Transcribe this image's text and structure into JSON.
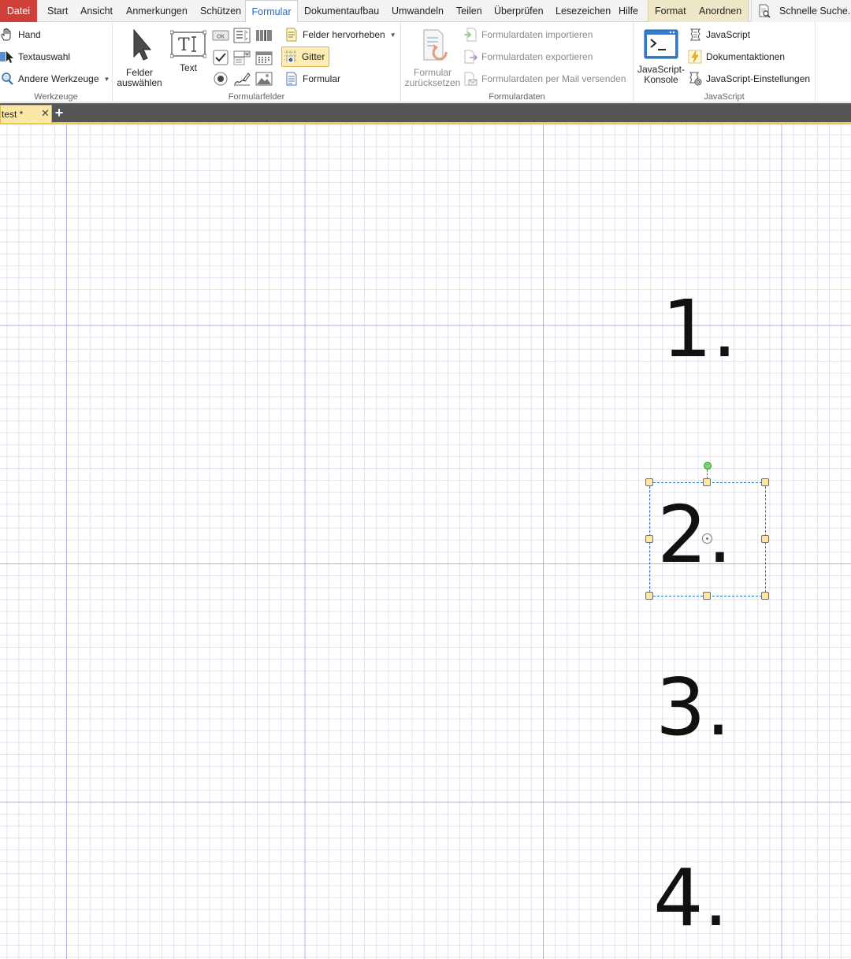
{
  "menu": {
    "tabs": [
      {
        "id": "datei",
        "label": "Datei"
      },
      {
        "id": "start",
        "label": "Start"
      },
      {
        "id": "ansicht",
        "label": "Ansicht"
      },
      {
        "id": "anmerkungen",
        "label": "Anmerkungen"
      },
      {
        "id": "schuetzen",
        "label": "Schützen"
      },
      {
        "id": "formular",
        "label": "Formular",
        "active": true
      },
      {
        "id": "dokumentaufbau",
        "label": "Dokumentaufbau"
      },
      {
        "id": "umwandeln",
        "label": "Umwandeln"
      },
      {
        "id": "teilen",
        "label": "Teilen"
      },
      {
        "id": "ueberpruefen",
        "label": "Überprüfen"
      },
      {
        "id": "lesezeichen",
        "label": "Lesezeichen"
      },
      {
        "id": "hilfe",
        "label": "Hilfe"
      },
      {
        "id": "format",
        "label": "Format",
        "contextual": true
      },
      {
        "id": "anordnen",
        "label": "Anordnen",
        "contextual": true
      }
    ],
    "search_label": "Schnelle Suche..."
  },
  "ribbon": {
    "werkzeuge": {
      "label": "Werkzeuge",
      "hand": "Hand",
      "textauswahl": "Textauswahl",
      "andere": "Andere Werkzeuge"
    },
    "formularfelder": {
      "label": "Formularfelder",
      "felder_line1": "Felder",
      "felder_line2": "auswählen",
      "text": "Text",
      "ok_button": "OK",
      "felder_hervorheben": "Felder hervorheben",
      "gitter": "Gitter",
      "formular": "Formular"
    },
    "formulardaten": {
      "label": "Formulardaten",
      "reset_line1": "Formular",
      "reset_line2": "zurücksetzen",
      "import": "Formulardaten importieren",
      "export": "Formulardaten exportieren",
      "mail": "Formulardaten per Mail versenden"
    },
    "javascript": {
      "label": "JavaScript",
      "console_line1": "JavaScript-",
      "console_line2": "Konsole",
      "javascript": "JavaScript",
      "dokumentaktionen": "Dokumentaktionen",
      "einstellungen": "JavaScript-Einstellungen"
    }
  },
  "document": {
    "tab_label": "test *",
    "close_glyph": "✕",
    "new_tab_glyph": "+",
    "items": [
      "1.",
      "2.",
      "3.",
      "4."
    ],
    "selected_index": 1
  },
  "colors": {
    "accent": "#2a6bb8",
    "datei_tab": "#d0403a",
    "contextual_band": "#efe8c8",
    "selection_border": "#2e76c9",
    "grid_major": "#8c8ccd",
    "tab_strip": "#555555",
    "tab_underline": "#f2c84b"
  }
}
